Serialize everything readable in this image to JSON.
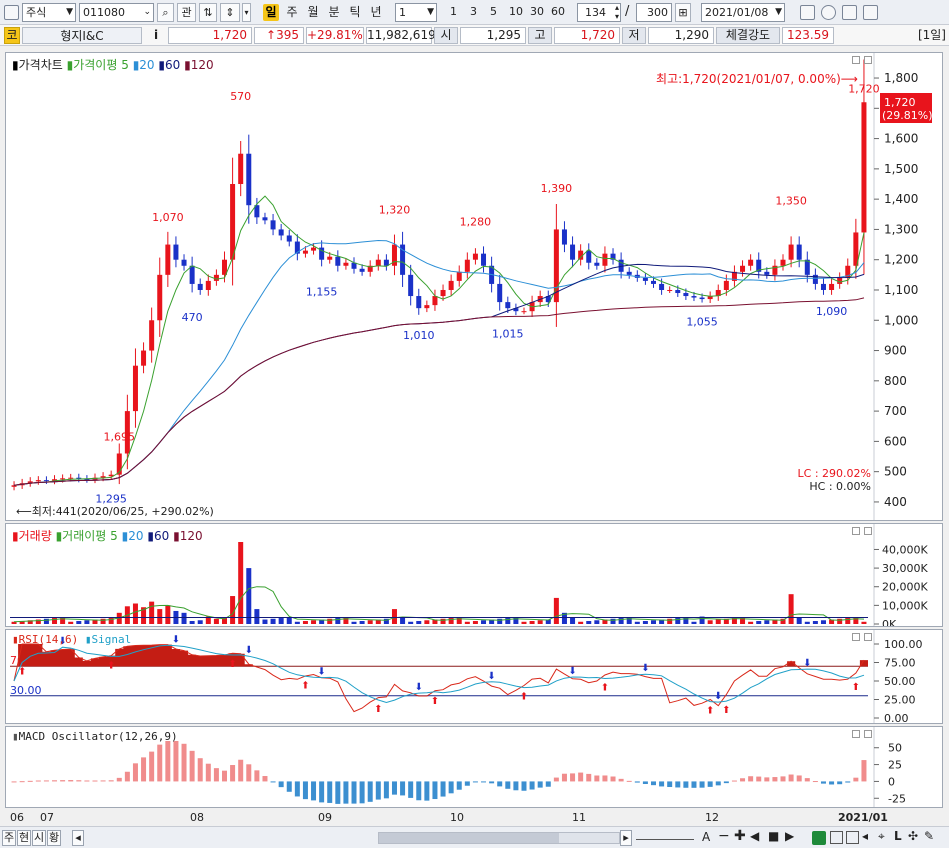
{
  "toolbar": {
    "market": "주식",
    "code": "011080",
    "btn_search": "⌕",
    "btn_gwan": "관",
    "periods": [
      "일",
      "주",
      "월",
      "분",
      "틱",
      "년"
    ],
    "active_period": "일",
    "interval": "1",
    "quick_intervals": [
      "1",
      "3",
      "5",
      "10",
      "30",
      "60"
    ],
    "visible_count": "134",
    "slash": "/",
    "total_count": "300",
    "date": "2021/01/08"
  },
  "quote": {
    "code_tag": "코",
    "name": "형지I&C",
    "info_icon": "i",
    "price": "1,720",
    "change": "↑395",
    "change_pct": "+29.81%",
    "volume": "11,982,619",
    "open_label": "시",
    "open": "1,295",
    "high_label": "고",
    "high": "1,720",
    "low_label": "저",
    "low": "1,290",
    "strength_label": "체결강도",
    "strength": "123.59",
    "period_tag": "[1일]"
  },
  "price_panel": {
    "legend": {
      "title": "가격차트",
      "ma_label": "가격이평",
      "periods": [
        "5",
        "20",
        "60",
        "120"
      ]
    },
    "max_note": "최고:1,720(2021/01/07, 0.00%)⟶",
    "min_note": "⟵최저:441(2020/06/25, +290.02%)",
    "last_price": "1,720",
    "last_pct": "(29.81%)",
    "lc_note": "LC : 290.02%",
    "hc_note": "HC :   0.00%",
    "y_ticks": [
      "1,800",
      "1,700",
      "1,600",
      "1,500",
      "1,400",
      "1,300",
      "1,200",
      "1,100",
      "1,000",
      "900",
      "800",
      "700",
      "600",
      "500",
      "400"
    ],
    "annotations": [
      "1,695",
      "1,295",
      "1,070",
      "570",
      "470",
      "1,155",
      "1,320",
      "1,010",
      "1,280",
      "1,015",
      "1,390",
      "1,055",
      "1,350",
      "1,090",
      "1,720"
    ]
  },
  "volume_panel": {
    "legend": {
      "title": "거래량",
      "ma_label": "거래이평",
      "periods": [
        "5",
        "20",
        "60",
        "120"
      ]
    },
    "y_ticks": [
      "40,000K",
      "30,000K",
      "20,000K",
      "10,000K",
      "0K"
    ]
  },
  "rsi_panel": {
    "legend": {
      "title": "RSI(14,6)",
      "signal": "Signal"
    },
    "level_high": "70.00",
    "level_low": "30.00",
    "y_ticks": [
      "100.00",
      "75.00",
      "50.00",
      "25.00",
      "0.00"
    ]
  },
  "macd_panel": {
    "legend": {
      "title": "MACD Oscillator(12,26,9)"
    },
    "y_ticks": [
      "50",
      "25",
      "0",
      "-25"
    ]
  },
  "x_axis": {
    "labels": [
      "06",
      "07",
      "08",
      "09",
      "10",
      "11",
      "12",
      "2021/01"
    ]
  },
  "bottombar": {
    "tabs": [
      "주",
      "현",
      "시",
      "황"
    ],
    "prev": "◂",
    "next": "▸",
    "zoom_letter": "A"
  },
  "colors": {
    "up": "#e8141c",
    "down": "#1a31c8",
    "ma5": "#3aa12f",
    "ma20": "#2c8fd6",
    "ma60": "#101a7a",
    "ma120": "#7a1030",
    "rsi": "#d9281a",
    "signal": "#20a0c8",
    "macd_pos": "#f08c8c",
    "macd_neg": "#3c8fd0"
  },
  "chart_data": [
    {
      "type": "candlestick",
      "title": "가격차트",
      "x_range": [
        "2020/06",
        "2021/01/08"
      ],
      "y_axis": {
        "ticks": [
          400,
          500,
          600,
          700,
          800,
          900,
          1000,
          1100,
          1200,
          1300,
          1400,
          1500,
          1600,
          1700,
          1800
        ]
      },
      "annotated_points": [
        {
          "label": "570",
          "price": 570
        },
        {
          "label": "470",
          "price": 470
        },
        {
          "label": "1,295",
          "price": 1295
        },
        {
          "label": "1,695",
          "price": 1695
        },
        {
          "label": "1,070",
          "price": 1070
        },
        {
          "label": "1,155",
          "price": 1155
        },
        {
          "label": "1,320",
          "price": 1320
        },
        {
          "label": "1,010",
          "price": 1010
        },
        {
          "label": "1,280",
          "price": 1280
        },
        {
          "label": "1,015",
          "price": 1015
        },
        {
          "label": "1,390",
          "price": 1390
        },
        {
          "label": "1,055",
          "price": 1055
        },
        {
          "label": "1,350",
          "price": 1350
        },
        {
          "label": "1,090",
          "price": 1090
        },
        {
          "label": "1,720",
          "price": 1720
        }
      ],
      "close_series": [
        455,
        462,
        468,
        472,
        470,
        475,
        478,
        480,
        476,
        474,
        480,
        485,
        490,
        560,
        700,
        850,
        900,
        1000,
        1150,
        1250,
        1200,
        1180,
        1120,
        1100,
        1130,
        1150,
        1200,
        1450,
        1550,
        1380,
        1340,
        1330,
        1300,
        1280,
        1260,
        1220,
        1230,
        1240,
        1200,
        1210,
        1180,
        1190,
        1170,
        1160,
        1180,
        1200,
        1180,
        1250,
        1150,
        1080,
        1040,
        1050,
        1080,
        1100,
        1130,
        1160,
        1200,
        1220,
        1180,
        1120,
        1060,
        1040,
        1030,
        1030,
        1060,
        1080,
        1060,
        1300,
        1250,
        1200,
        1230,
        1190,
        1180,
        1220,
        1200,
        1160,
        1150,
        1140,
        1130,
        1120,
        1100,
        1100,
        1090,
        1080,
        1075,
        1070,
        1080,
        1100,
        1130,
        1160,
        1180,
        1200,
        1160,
        1150,
        1180,
        1200,
        1250,
        1200,
        1150,
        1120,
        1100,
        1120,
        1140,
        1180,
        1290,
        1720
      ]
    },
    {
      "type": "bar",
      "title": "거래량",
      "y_axis": {
        "ticks_K": [
          0,
          10000,
          20000,
          30000,
          40000
        ]
      },
      "notes": "volume bars; major spikes near August (~44,000K) and end of series (~12,000K)"
    },
    {
      "type": "line",
      "title": "RSI(14,6)",
      "levels": [
        70,
        30
      ],
      "y_axis": {
        "ticks": [
          0,
          25,
          50,
          75,
          100
        ]
      }
    },
    {
      "type": "bar",
      "title": "MACD Oscillator(12,26,9)",
      "y_axis": {
        "ticks": [
          -25,
          0,
          25,
          50
        ]
      }
    }
  ]
}
